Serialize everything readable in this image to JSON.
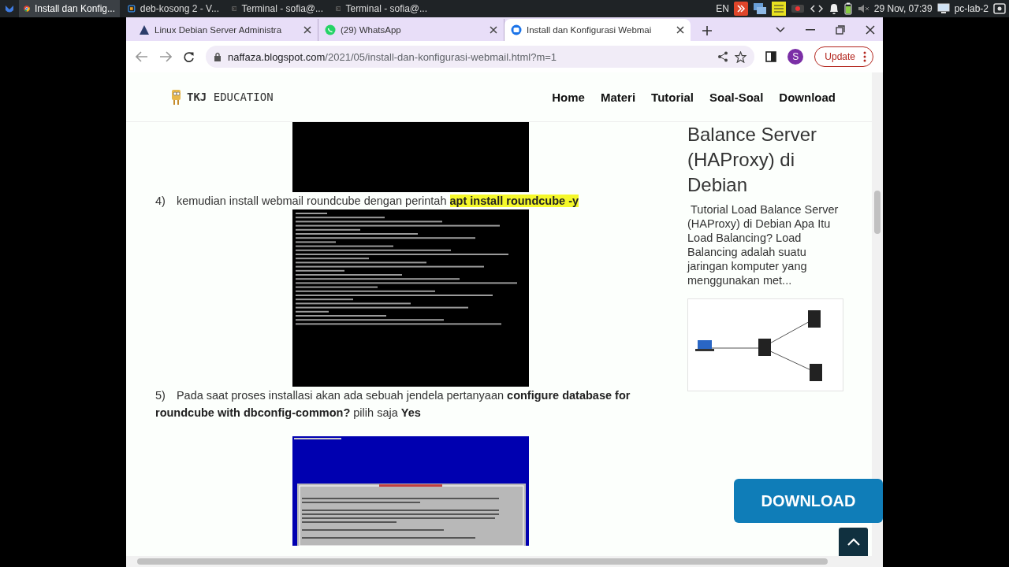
{
  "taskbar": {
    "tasks": [
      {
        "label": "Install dan Konfig...",
        "kind": "chrome",
        "selected": true
      },
      {
        "label": "deb-kosong 2 - V...",
        "kind": "vbox",
        "selected": false
      },
      {
        "label": "Terminal - sofia@...",
        "kind": "terminal",
        "selected": false
      },
      {
        "label": "Terminal - sofia@...",
        "kind": "terminal",
        "selected": false
      }
    ],
    "keyboard_layout": "EN",
    "clock": "29 Nov, 07:39",
    "hostname": "pc-lab-2"
  },
  "browser": {
    "tabs": [
      {
        "title": "Linux Debian Server Administra",
        "kind": "web",
        "selected": false
      },
      {
        "title": "(29) WhatsApp",
        "kind": "whatsapp",
        "selected": false
      },
      {
        "title": "Install dan Konfigurasi Webmai",
        "kind": "blogger",
        "selected": true
      }
    ],
    "url_host": "naffaza.blogspot.com",
    "url_path": "/2021/05/install-dan-konfigurasi-webmail.html?m=1",
    "profile_initial": "S",
    "update_label": "Update"
  },
  "site": {
    "logo": "**TKJ** EDUCATION",
    "nav": [
      "Home",
      "Materi",
      "Tutorial",
      "Soal-Soal",
      "Download"
    ]
  },
  "content": [
    {
      "kind": "terminal-screenshot"
    },
    {
      "kind": "step",
      "number": "4)",
      "text": "kemudian install webmail roundcube dengan perintah",
      "command": "apt install roundcube -y"
    },
    {
      "kind": "terminal-screenshot"
    },
    {
      "kind": "step",
      "number": "5)",
      "text": "Pada saat proses installasi akan ada sebuah jendela pertanyaan **configure database for roundcube with dbconfig-common?** pilih saja **Yes**"
    },
    {
      "kind": "dialog-screenshot"
    }
  ],
  "sidebar": {
    "post_title": "Balance Server (HAProxy) di Debian",
    "excerpt": " Tutorial Load Balance Server (HAProxy) di Debian Apa Itu Load Balancing? Load Balancing adalah suatu jaringan komputer yang menggunakan met..."
  },
  "download_button": "DOWNLOAD"
}
